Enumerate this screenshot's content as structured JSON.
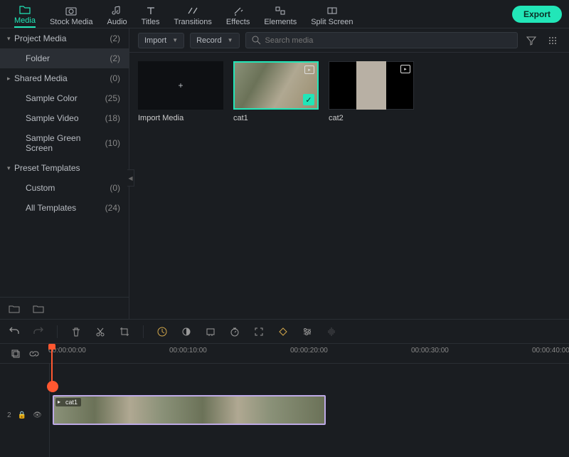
{
  "tabs": [
    {
      "label": "Media"
    },
    {
      "label": "Stock Media"
    },
    {
      "label": "Audio"
    },
    {
      "label": "Titles"
    },
    {
      "label": "Transitions"
    },
    {
      "label": "Effects"
    },
    {
      "label": "Elements"
    },
    {
      "label": "Split Screen"
    }
  ],
  "export_label": "Export",
  "sidebar": {
    "items": [
      {
        "label": "Project Media",
        "count": "(2)",
        "arrow": "▾",
        "top": true
      },
      {
        "label": "Folder",
        "count": "(2)",
        "child": true,
        "sel": true
      },
      {
        "label": "Shared Media",
        "count": "(0)",
        "arrow": "▸",
        "top": true
      },
      {
        "label": "Sample Color",
        "count": "(25)",
        "child": true
      },
      {
        "label": "Sample Video",
        "count": "(18)",
        "child": true
      },
      {
        "label": "Sample Green Screen",
        "count": "(10)",
        "child": true
      },
      {
        "label": "Preset Templates",
        "count": "",
        "arrow": "▾",
        "top": true
      },
      {
        "label": "Custom",
        "count": "(0)",
        "child": true
      },
      {
        "label": "All Templates",
        "count": "(24)",
        "child": true
      }
    ]
  },
  "content": {
    "import_label": "Import",
    "record_label": "Record",
    "search_placeholder": "Search media"
  },
  "thumbs": [
    {
      "label": "Import Media",
      "type": "plus"
    },
    {
      "label": "cat1",
      "type": "img",
      "sel": true
    },
    {
      "label": "cat2",
      "type": "img2"
    }
  ],
  "ruler": [
    "00:00:00:00",
    "00:00:10:00",
    "00:00:20:00",
    "00:00:30:00",
    "00:00:40:00"
  ],
  "clip_label": "cat1",
  "track_num": "2"
}
